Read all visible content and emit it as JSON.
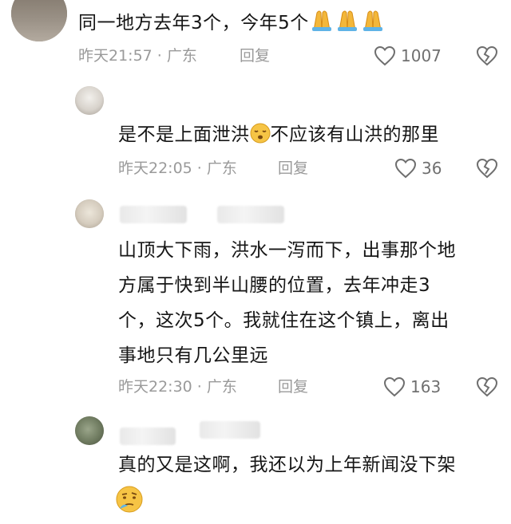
{
  "comments": [
    {
      "text": "同一地方去年3个，今年5个",
      "time": "昨天21:57",
      "location": "广东",
      "reply_label": "回复",
      "likes": "1007"
    },
    {
      "text": "是不是上面泄洪",
      "text_after_emoji": "不应该有山洪的那里",
      "time": "昨天22:05",
      "location": "广东",
      "reply_label": "回复",
      "likes": "36"
    },
    {
      "lines": [
        "山顶大下雨，洪水一泻而下，出事那个地",
        "方属于快到半山腰的位置，去年冲走3",
        "个，这次5个。我就住在这个镇上，离出",
        "事地只有几公里远"
      ],
      "time": "昨天22:30",
      "location": "广东",
      "reply_label": "回复",
      "likes": "163"
    },
    {
      "text": "真的又是这啊，我还以为上年新闻没下架"
    }
  ],
  "separator": "·",
  "icons": [
    "pray-emoji",
    "heart-icon",
    "dislike-heart-icon",
    "sleepy-emoji",
    "thinking-emoji"
  ],
  "colors": {
    "meta": "#9a9a9a",
    "text": "#161616",
    "background": "#ffffff"
  }
}
